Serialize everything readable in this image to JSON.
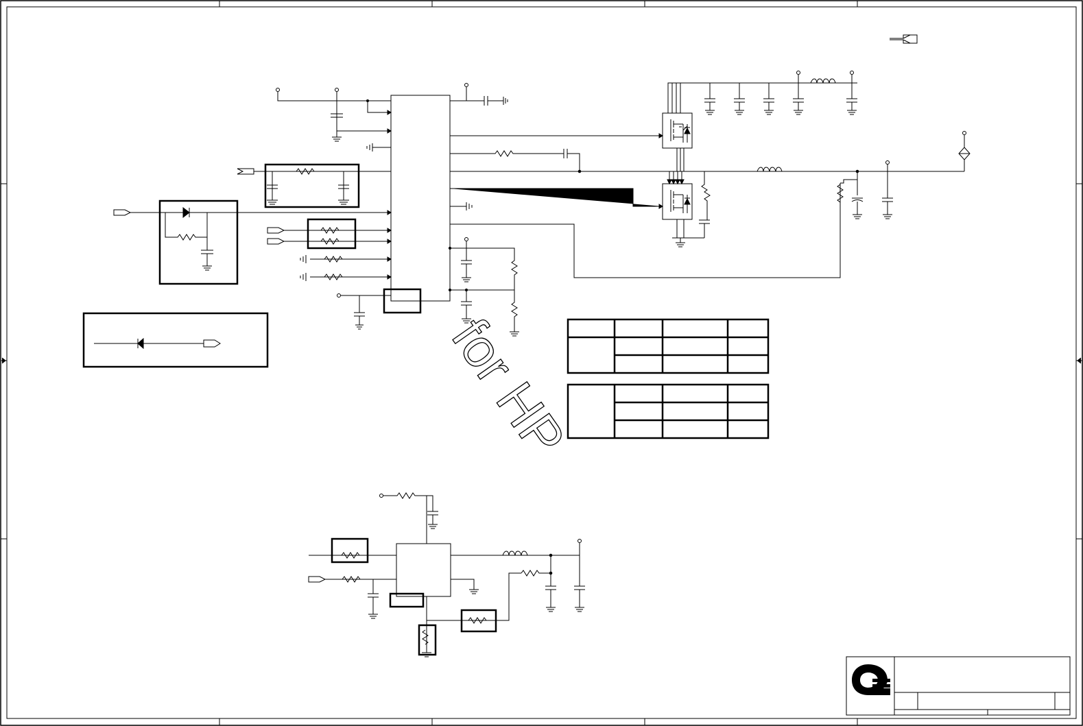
{
  "sheet": {
    "watermark": "for HP",
    "logo_icon": "quanta-logo-icon"
  },
  "colors": {
    "line": "#000000",
    "background": "#ffffff",
    "watermark": "#000000"
  },
  "tables": {
    "upper_rows": 3,
    "lower_rows": 3,
    "columns": 4
  }
}
